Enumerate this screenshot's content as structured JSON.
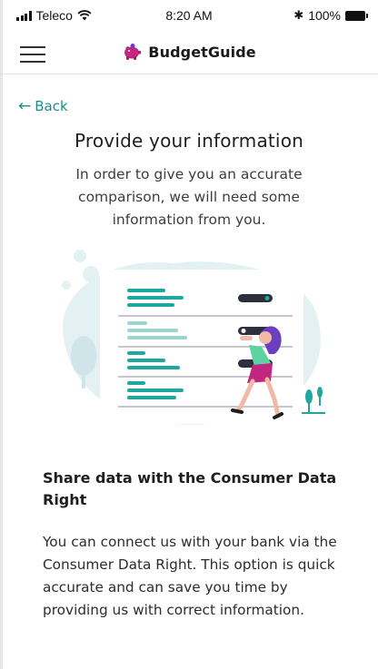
{
  "status_bar": {
    "carrier": "Teleco",
    "time": "8:20 AM",
    "bluetooth": "✱",
    "battery": "100%"
  },
  "navbar": {
    "menu_icon": "hamburger-menu-icon",
    "logo_icon": "piggy-bank-icon",
    "brand": "BudgetGuide"
  },
  "back": {
    "arrow": "←",
    "label": "Back"
  },
  "page": {
    "title": "Provide your information",
    "intro": "In order to give you an accurate comparison, we will need some information from you."
  },
  "illustration": {
    "icon": "person-sorting-data-illustration"
  },
  "section": {
    "title": "Share data with the Consumer Data Right",
    "body": "You can connect us with your bank via the Consumer Data Right. This option is quick accurate and can save you time by providing us with correct information."
  },
  "colors": {
    "accent": "#1a8f86",
    "teal": "#1fa8a0",
    "brand_pink": "#c2277f",
    "purple": "#6c3fc1"
  }
}
